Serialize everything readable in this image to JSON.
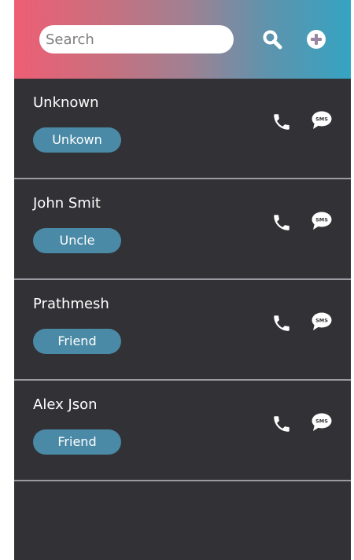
{
  "search": {
    "placeholder": "Search",
    "value": ""
  },
  "header": {
    "search_icon": "search-icon",
    "add_icon": "plus-circle-icon"
  },
  "contacts": [
    {
      "name": "Unknown",
      "tag": "Unkown"
    },
    {
      "name": "John Smit",
      "tag": "Uncle"
    },
    {
      "name": "Prathmesh",
      "tag": "Friend"
    },
    {
      "name": "Alex Json",
      "tag": "Friend"
    }
  ],
  "sms_label": "SMS",
  "colors": {
    "gradient_start": "#ee5e74",
    "gradient_end": "#35a4c2",
    "background": "#323236",
    "tag": "#4a8aa6",
    "divider": "#9a9aa2"
  }
}
